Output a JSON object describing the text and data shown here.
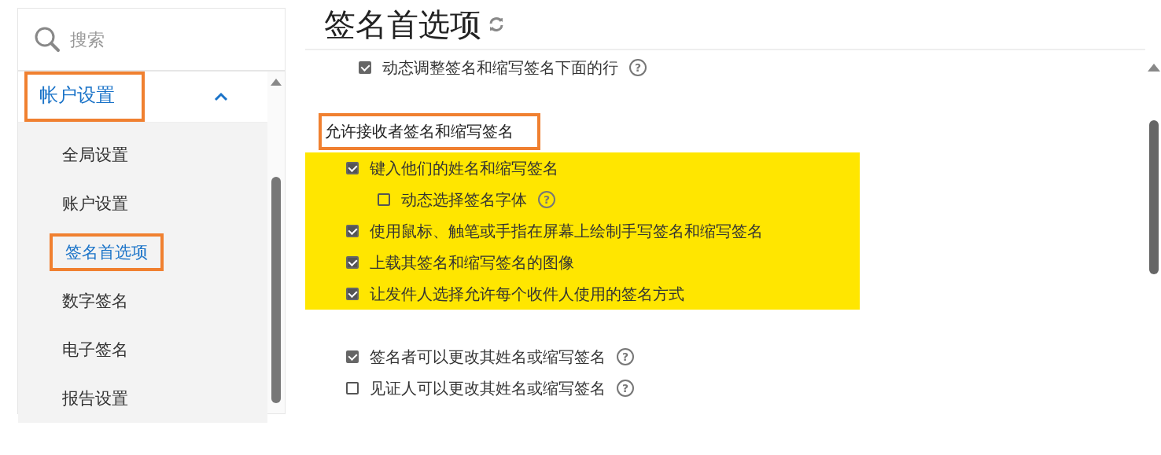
{
  "sidebar": {
    "search": {
      "placeholder": "搜索"
    },
    "section": {
      "label": "帐户设置",
      "expanded": true,
      "outlined": true
    },
    "items": [
      {
        "label": "全局设置",
        "selected": false,
        "outlined": false
      },
      {
        "label": "账户设置",
        "selected": false,
        "outlined": false
      },
      {
        "label": "签名首选项",
        "selected": true,
        "outlined": true
      },
      {
        "label": "数字签名",
        "selected": false,
        "outlined": false
      },
      {
        "label": "电子签名",
        "selected": false,
        "outlined": false
      },
      {
        "label": "报告设置",
        "selected": false,
        "outlined": false
      }
    ]
  },
  "main": {
    "title": "签名首选项",
    "options_above": [
      {
        "label": "动态调整签名和缩写签名下面的行",
        "checked": true,
        "help": "?"
      }
    ],
    "group": {
      "heading": "允许接收者签名和缩写签名",
      "outlined": true,
      "options": [
        {
          "label": "键入他们的姓名和缩写签名",
          "checked": true,
          "highlighted": true,
          "children": [
            {
              "label": "动态选择签名字体",
              "checked": false,
              "highlighted": true,
              "help": "?"
            }
          ]
        },
        {
          "label": "使用鼠标、触笔或手指在屏幕上绘制手写签名和缩写签名",
          "checked": true,
          "highlighted": true
        },
        {
          "label": "上载其签名和缩写签名的图像",
          "checked": true,
          "highlighted": true
        },
        {
          "label": "让发件人选择允许每个收件人使用的签名方式",
          "checked": true,
          "highlighted": true
        }
      ]
    },
    "options_below": [
      {
        "label": "签名者可以更改其姓名或缩写签名",
        "checked": true,
        "help": "?"
      },
      {
        "label": "见证人可以更改其姓名或缩写签名",
        "checked": false,
        "help": "?"
      }
    ]
  }
}
